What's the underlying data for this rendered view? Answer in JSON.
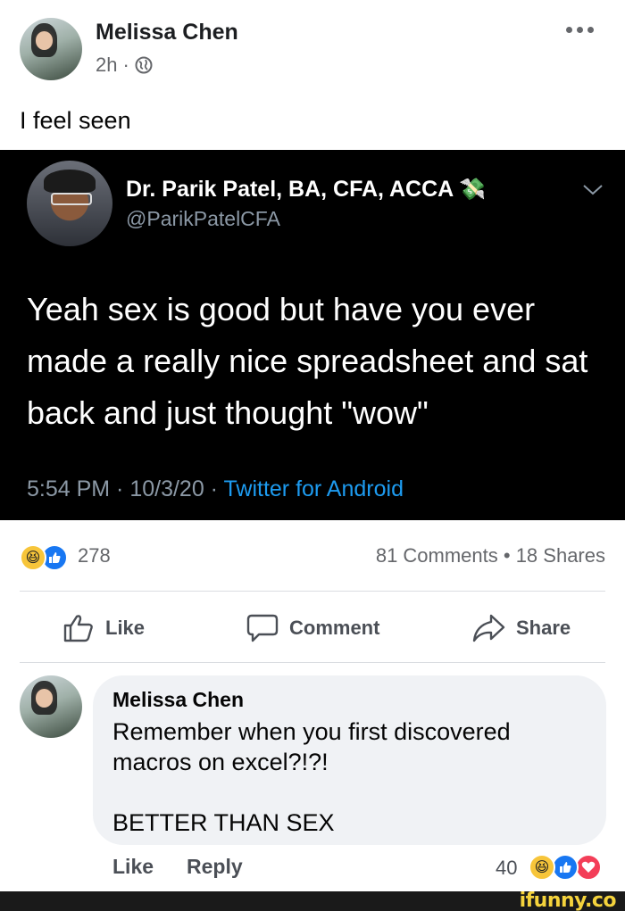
{
  "post": {
    "author": "Melissa Chen",
    "time": "2h",
    "separator": "·",
    "privacy_icon": "globe-icon",
    "more_icon": "more-options-icon",
    "caption": "I feel seen"
  },
  "tweet": {
    "name": "Dr. Parik Patel, BA, CFA, ACCA",
    "emoji": "money-with-wings-icon",
    "handle": "@ParikPatelCFA",
    "text": "Yeah sex is good but have you ever made a really nice spreadsheet and sat back and just thought \"wow\"",
    "timestamp": "5:54 PM · 10/3/20 · ",
    "source": "Twitter for Android"
  },
  "stats": {
    "reaction_count": "278",
    "comments_shares": "81 Comments • 18 Shares"
  },
  "actions": {
    "like": "Like",
    "comment": "Comment",
    "share": "Share"
  },
  "comment": {
    "author": "Melissa Chen",
    "line1": "Remember when you first discovered",
    "line2": "macros on excel?!?!",
    "line3": "BETTER THAN SEX",
    "like": "Like",
    "reply": "Reply",
    "reaction_count": "40"
  },
  "watermark": "ifunny.co",
  "colors": {
    "facebook_blue": "#1877f2",
    "twitter_link": "#1d9bf0",
    "tweet_bg": "#000000",
    "comment_bg": "#f0f2f5"
  }
}
